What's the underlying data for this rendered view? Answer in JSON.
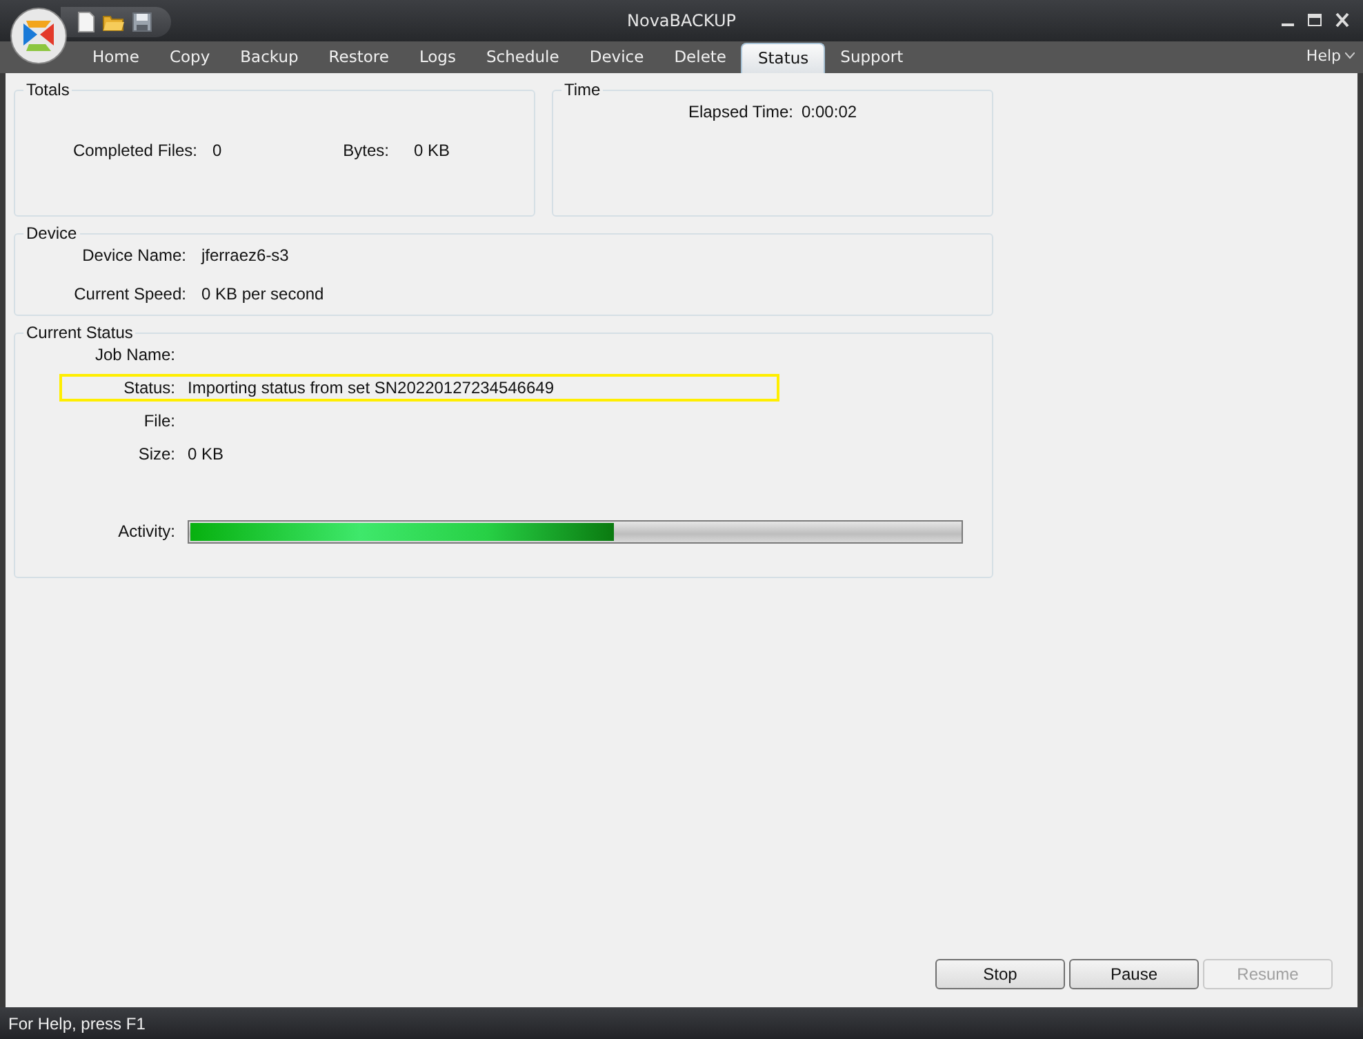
{
  "window": {
    "title": "NovaBACKUP"
  },
  "tabs": [
    {
      "label": "Home",
      "selected": false
    },
    {
      "label": "Copy",
      "selected": false
    },
    {
      "label": "Backup",
      "selected": false
    },
    {
      "label": "Restore",
      "selected": false
    },
    {
      "label": "Logs",
      "selected": false
    },
    {
      "label": "Schedule",
      "selected": false
    },
    {
      "label": "Device",
      "selected": false
    },
    {
      "label": "Delete",
      "selected": false
    },
    {
      "label": "Status",
      "selected": true
    },
    {
      "label": "Support",
      "selected": false
    }
  ],
  "help_menu": {
    "label": "Help"
  },
  "totals": {
    "title": "Totals",
    "fields": [
      {
        "label": "Completed Files:",
        "value": "0"
      },
      {
        "label": "Bytes:",
        "value": "0 KB"
      }
    ]
  },
  "time": {
    "title": "Time",
    "fields": [
      {
        "label": "Elapsed Time:",
        "value": "0:00:02"
      }
    ]
  },
  "device": {
    "title": "Device",
    "fields": [
      {
        "label": "Device Name:",
        "value": "jferraez6-s3"
      },
      {
        "label": "Current Speed:",
        "value": "0 KB per second"
      }
    ]
  },
  "current_status": {
    "title": "Current Status",
    "fields": [
      {
        "label": "Job Name:",
        "highlighted": false
      },
      {
        "label": "Status:",
        "value": "Importing status from set SN20220127234546649",
        "highlighted": true
      },
      {
        "label": "File:",
        "highlighted": false
      },
      {
        "label": "Size:",
        "value": "0 KB",
        "highlighted": false
      }
    ],
    "activity": {
      "label": "Activity:",
      "level": 0.55
    }
  },
  "buttons": [
    {
      "label": "Stop",
      "disabled": false
    },
    {
      "label": "Pause",
      "disabled": false
    },
    {
      "label": "Resume",
      "disabled": true
    }
  ],
  "status_bar": {
    "text": "For Help, press F1"
  }
}
